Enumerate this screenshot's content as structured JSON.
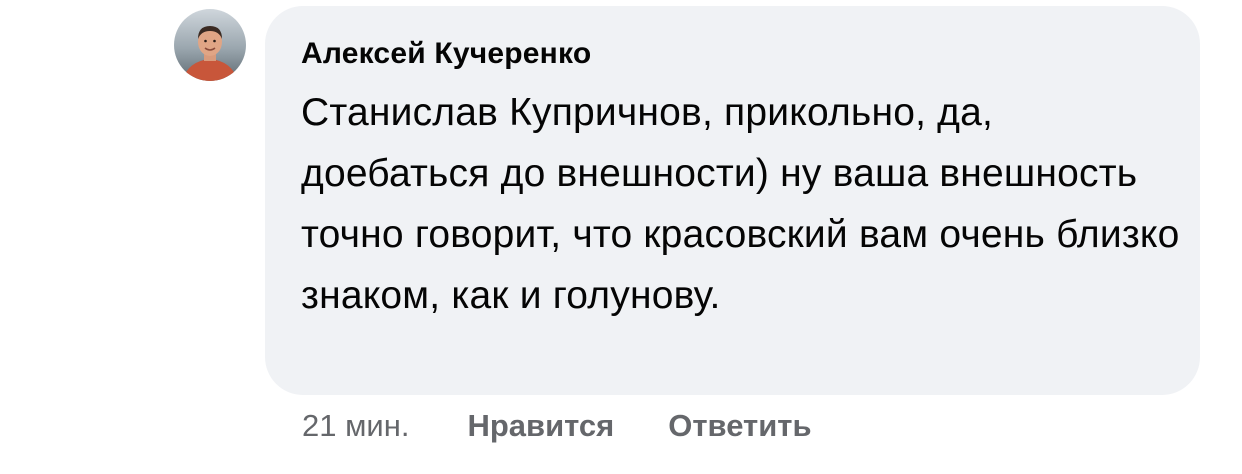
{
  "comment": {
    "author": "Алексей Кучеренко",
    "text": "Станислав Купричнов, прикольно, да, доебаться до внешности) ну ваша внешность точно говорит, что красовский вам очень близко знаком, как и голунову.",
    "time": "21 мин.",
    "like_label": "Нравится",
    "reply_label": "Ответить"
  },
  "colors": {
    "bubble_background": "#f0f2f5",
    "text": "#050505",
    "secondary_text": "#65676b"
  },
  "icons": {
    "avatar": "user-profile-photo"
  }
}
